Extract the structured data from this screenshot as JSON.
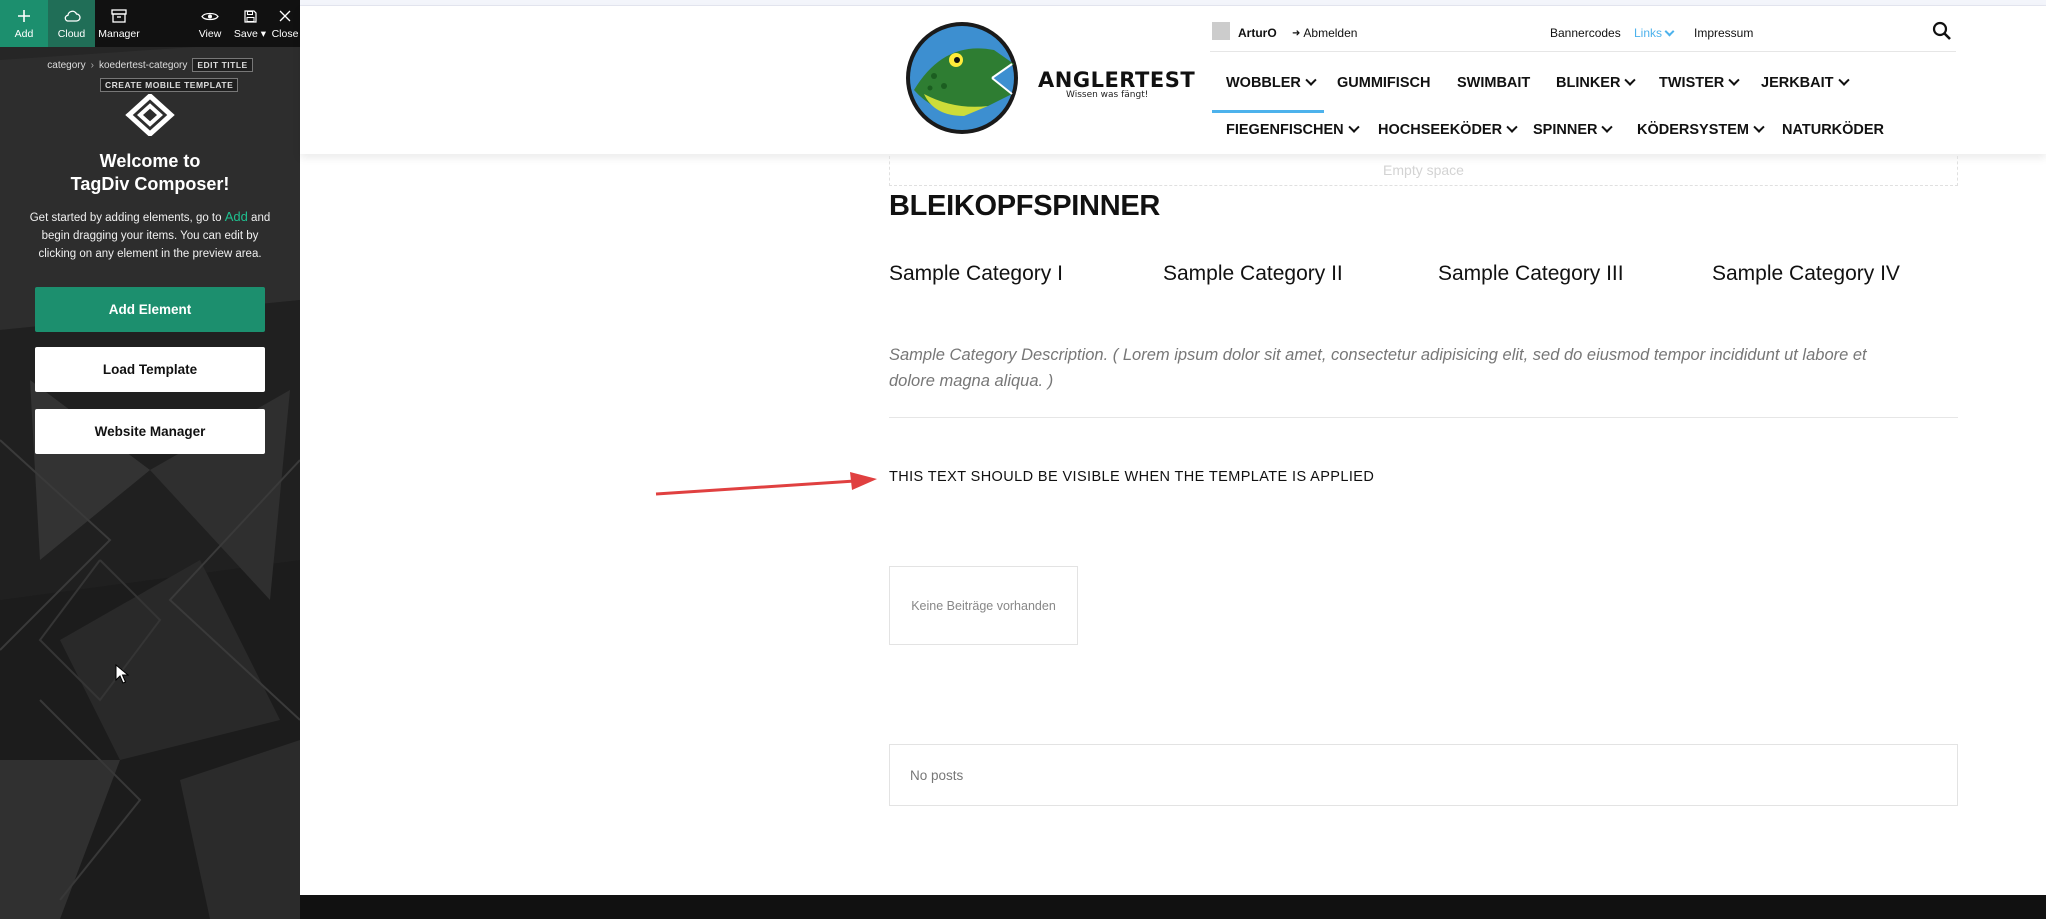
{
  "composer": {
    "toolbar": {
      "add_label": "Add",
      "cloud_label": "Cloud",
      "manager_label": "Manager",
      "view_label": "View",
      "save_label": "Save",
      "close_label": "Close"
    },
    "breadcrumb": {
      "part1": "category",
      "part2": "koedertest-category",
      "edit_title": "EDIT TITLE"
    },
    "create_mobile_template": "CREATE MOBILE TEMPLATE",
    "welcome_line1": "Welcome to",
    "welcome_line2": "TagDiv Composer!",
    "intro_before": "Get started by adding elements, go to ",
    "intro_accent": "Add",
    "intro_after": " and begin dragging your items. You can edit by clicking on any element in the preview area.",
    "buttons": {
      "add_element": "Add Element",
      "load_template": "Load Template",
      "website_manager": "Website Manager"
    },
    "colors": {
      "accent": "#1c8f6e",
      "panel_bg": "#2a2a2a"
    }
  },
  "site": {
    "brand": {
      "name": "ANGLERTEST",
      "tagline": "Wissen was fängt!"
    },
    "topbar": {
      "user": "ArturO",
      "logout": "Abmelden",
      "links": [
        "Bannercodes",
        "Links",
        "Impressum"
      ]
    },
    "nav": {
      "row1": [
        "WOBBLER",
        "GUMMIFISCH",
        "SWIMBAIT",
        "BLINKER",
        "TWISTER",
        "JERKBAIT"
      ],
      "row2": [
        "FIEGENFISCHEN",
        "HOCHSEEKÖDER",
        "SPINNER",
        "KÖDERSYSTEM",
        "NATURKÖDER"
      ],
      "active": "WOBBLER",
      "accent": "#4db2ec"
    },
    "empty_space": "Empty space",
    "page_title": "BLEIKOPFSPINNER",
    "categories": [
      "Sample Category I",
      "Sample Category II",
      "Sample Category III",
      "Sample Category IV"
    ],
    "category_description": "Sample Category Description. ( Lorem ipsum dolor sit amet, consectetur adipisicing elit, sed do eiusmod tempor incididunt ut labore et dolore magna aliqua. )",
    "template_text": "THIS TEXT SHOULD BE VISIBLE WHEN THE TEMPLATE IS APPLIED",
    "no_posts_de": "Keine Beiträge vorhanden",
    "no_posts_en": "No posts"
  }
}
